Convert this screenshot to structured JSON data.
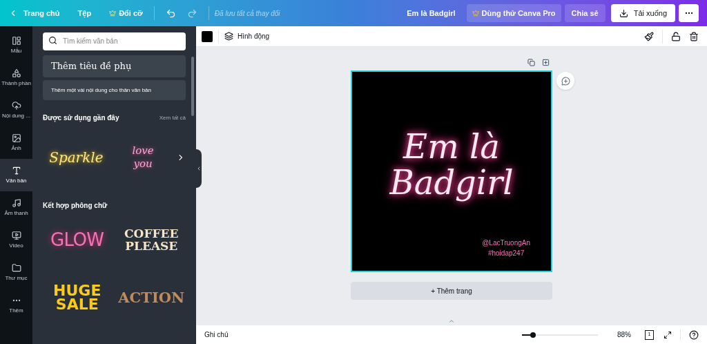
{
  "topbar": {
    "home": "Trang chủ",
    "file": "Tệp",
    "resize": "Đổi cỡ",
    "saved_status": "Đã lưu tất cả thay đổi",
    "design_title": "Em là Badgirl",
    "pro_button": "Dùng thử Canva Pro",
    "share_button": "Chia sẻ",
    "download_button": "Tải xuống"
  },
  "rail": [
    {
      "label": "Mẫu",
      "selected": false
    },
    {
      "label": "Thành phần",
      "selected": false
    },
    {
      "label": "Nội dung ...",
      "selected": false
    },
    {
      "label": "Ảnh",
      "selected": false
    },
    {
      "label": "Văn bản",
      "selected": true
    },
    {
      "label": "Âm thanh",
      "selected": false
    },
    {
      "label": "Video",
      "selected": false
    },
    {
      "label": "Thư mục",
      "selected": false
    },
    {
      "label": "Thêm",
      "selected": false
    }
  ],
  "panel": {
    "search": {
      "placeholder": "Tìm kiếm văn bản"
    },
    "add_subheading": "Thêm tiêu đề phụ",
    "add_body": "Thêm một vài nội dung cho thân văn bản",
    "recent": {
      "title": "Được sử dụng gần đây",
      "see_all": "Xem tất cả",
      "items": [
        {
          "text": "Sparkle",
          "kind": "neon-yellow"
        },
        {
          "text": "love you",
          "kind": "neon-pink"
        }
      ]
    },
    "combos": {
      "title": "Kết hợp phông chữ",
      "items": [
        {
          "text": "GLOW",
          "kind": "glow"
        },
        {
          "text": "COFFEE PLEASE",
          "kind": "coffee"
        },
        {
          "text": "HUGE SALE",
          "kind": "huge"
        },
        {
          "text": "ACTION",
          "kind": "action"
        }
      ]
    }
  },
  "toolbar": {
    "color": "#000000",
    "animate": "Hình động"
  },
  "canvas": {
    "headline_1": "Em là",
    "headline_2": "Badgirl",
    "credit_1": "@LacTruongAn",
    "credit_2": "#hoidap247",
    "add_page": "+ Thêm trang"
  },
  "footer": {
    "notes": "Ghi chú",
    "zoom": {
      "level": 0.15,
      "reading": "88%"
    },
    "page_count": "1"
  }
}
